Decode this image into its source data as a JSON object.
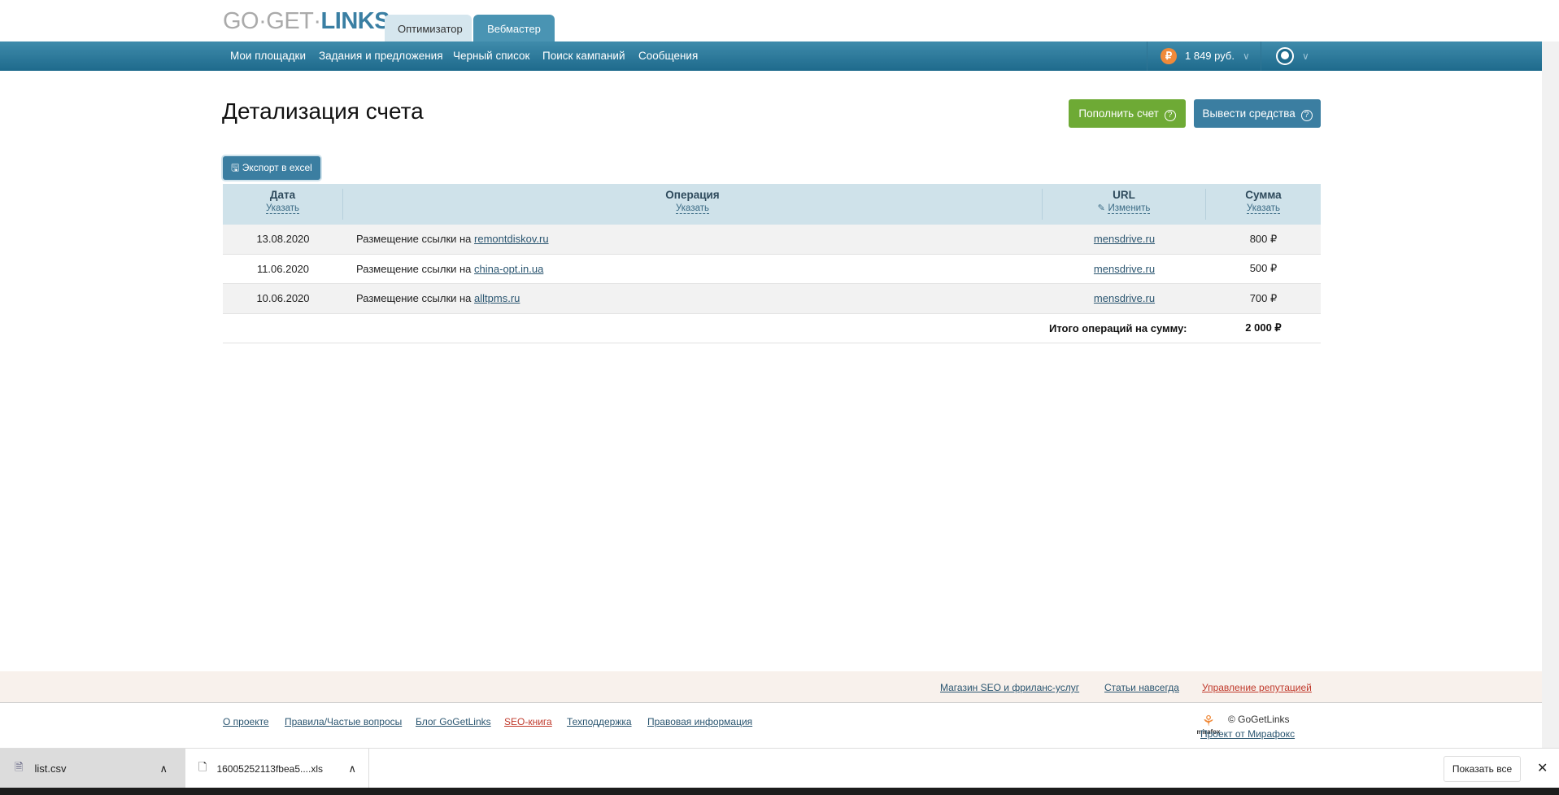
{
  "header": {
    "logo_gray": "GO·GET·",
    "logo_blue": "LINKS",
    "tabs": [
      "Оптимизатор",
      "Вебмастер"
    ],
    "active_tab": "Вебмастер",
    "nav": [
      "Мои площадки",
      "Задания и предложения",
      "Черный список",
      "Поиск кампаний",
      "Сообщения"
    ],
    "balance": "1 849 руб.",
    "currency_symbol": "₽"
  },
  "page": {
    "title": "Детализация счета",
    "topup_label": "Пополнить счет",
    "withdraw_label": "Вывести средства",
    "export_label": "Экспорт в excel"
  },
  "table": {
    "columns": [
      {
        "label": "Дата",
        "action": "Указать"
      },
      {
        "label": "Операция",
        "action": "Указать"
      },
      {
        "label": "URL",
        "action": "Изменить"
      },
      {
        "label": "Сумма",
        "action": "Указать"
      }
    ],
    "rows": [
      {
        "date": "13.08.2020",
        "op": "Размещение ссылки на ",
        "site": "remontdiskov.ru",
        "url": "mensdrive.ru",
        "sum": "800 ₽"
      },
      {
        "date": "11.06.2020",
        "op": "Размещение ссылки на ",
        "site": "china-opt.in.ua",
        "url": "mensdrive.ru",
        "sum": "500 ₽"
      },
      {
        "date": "10.06.2020",
        "op": "Размещение ссылки на ",
        "site": "alltpms.ru",
        "url": "mensdrive.ru",
        "sum": "700 ₽"
      }
    ],
    "total_label": "Итого операций на сумму:",
    "total_value": "2 000 ₽"
  },
  "footer": {
    "top_links": [
      "Магазин SEO и фриланс-услуг",
      "Статьи навсегда",
      "Управление репутацией"
    ],
    "links": [
      "О проекте",
      "Правила/Частые вопросы",
      "Блог GoGetLinks",
      "SEO-книга",
      "Техподдержка",
      "Правовая информация"
    ],
    "copyright": "© GoGetLinks",
    "project": "Проект от Мирафокс",
    "mirafox": "mirafox"
  },
  "downloads": {
    "files": [
      "list.csv",
      "16005252113fbea5....xls"
    ],
    "show_all": "Показать все"
  }
}
